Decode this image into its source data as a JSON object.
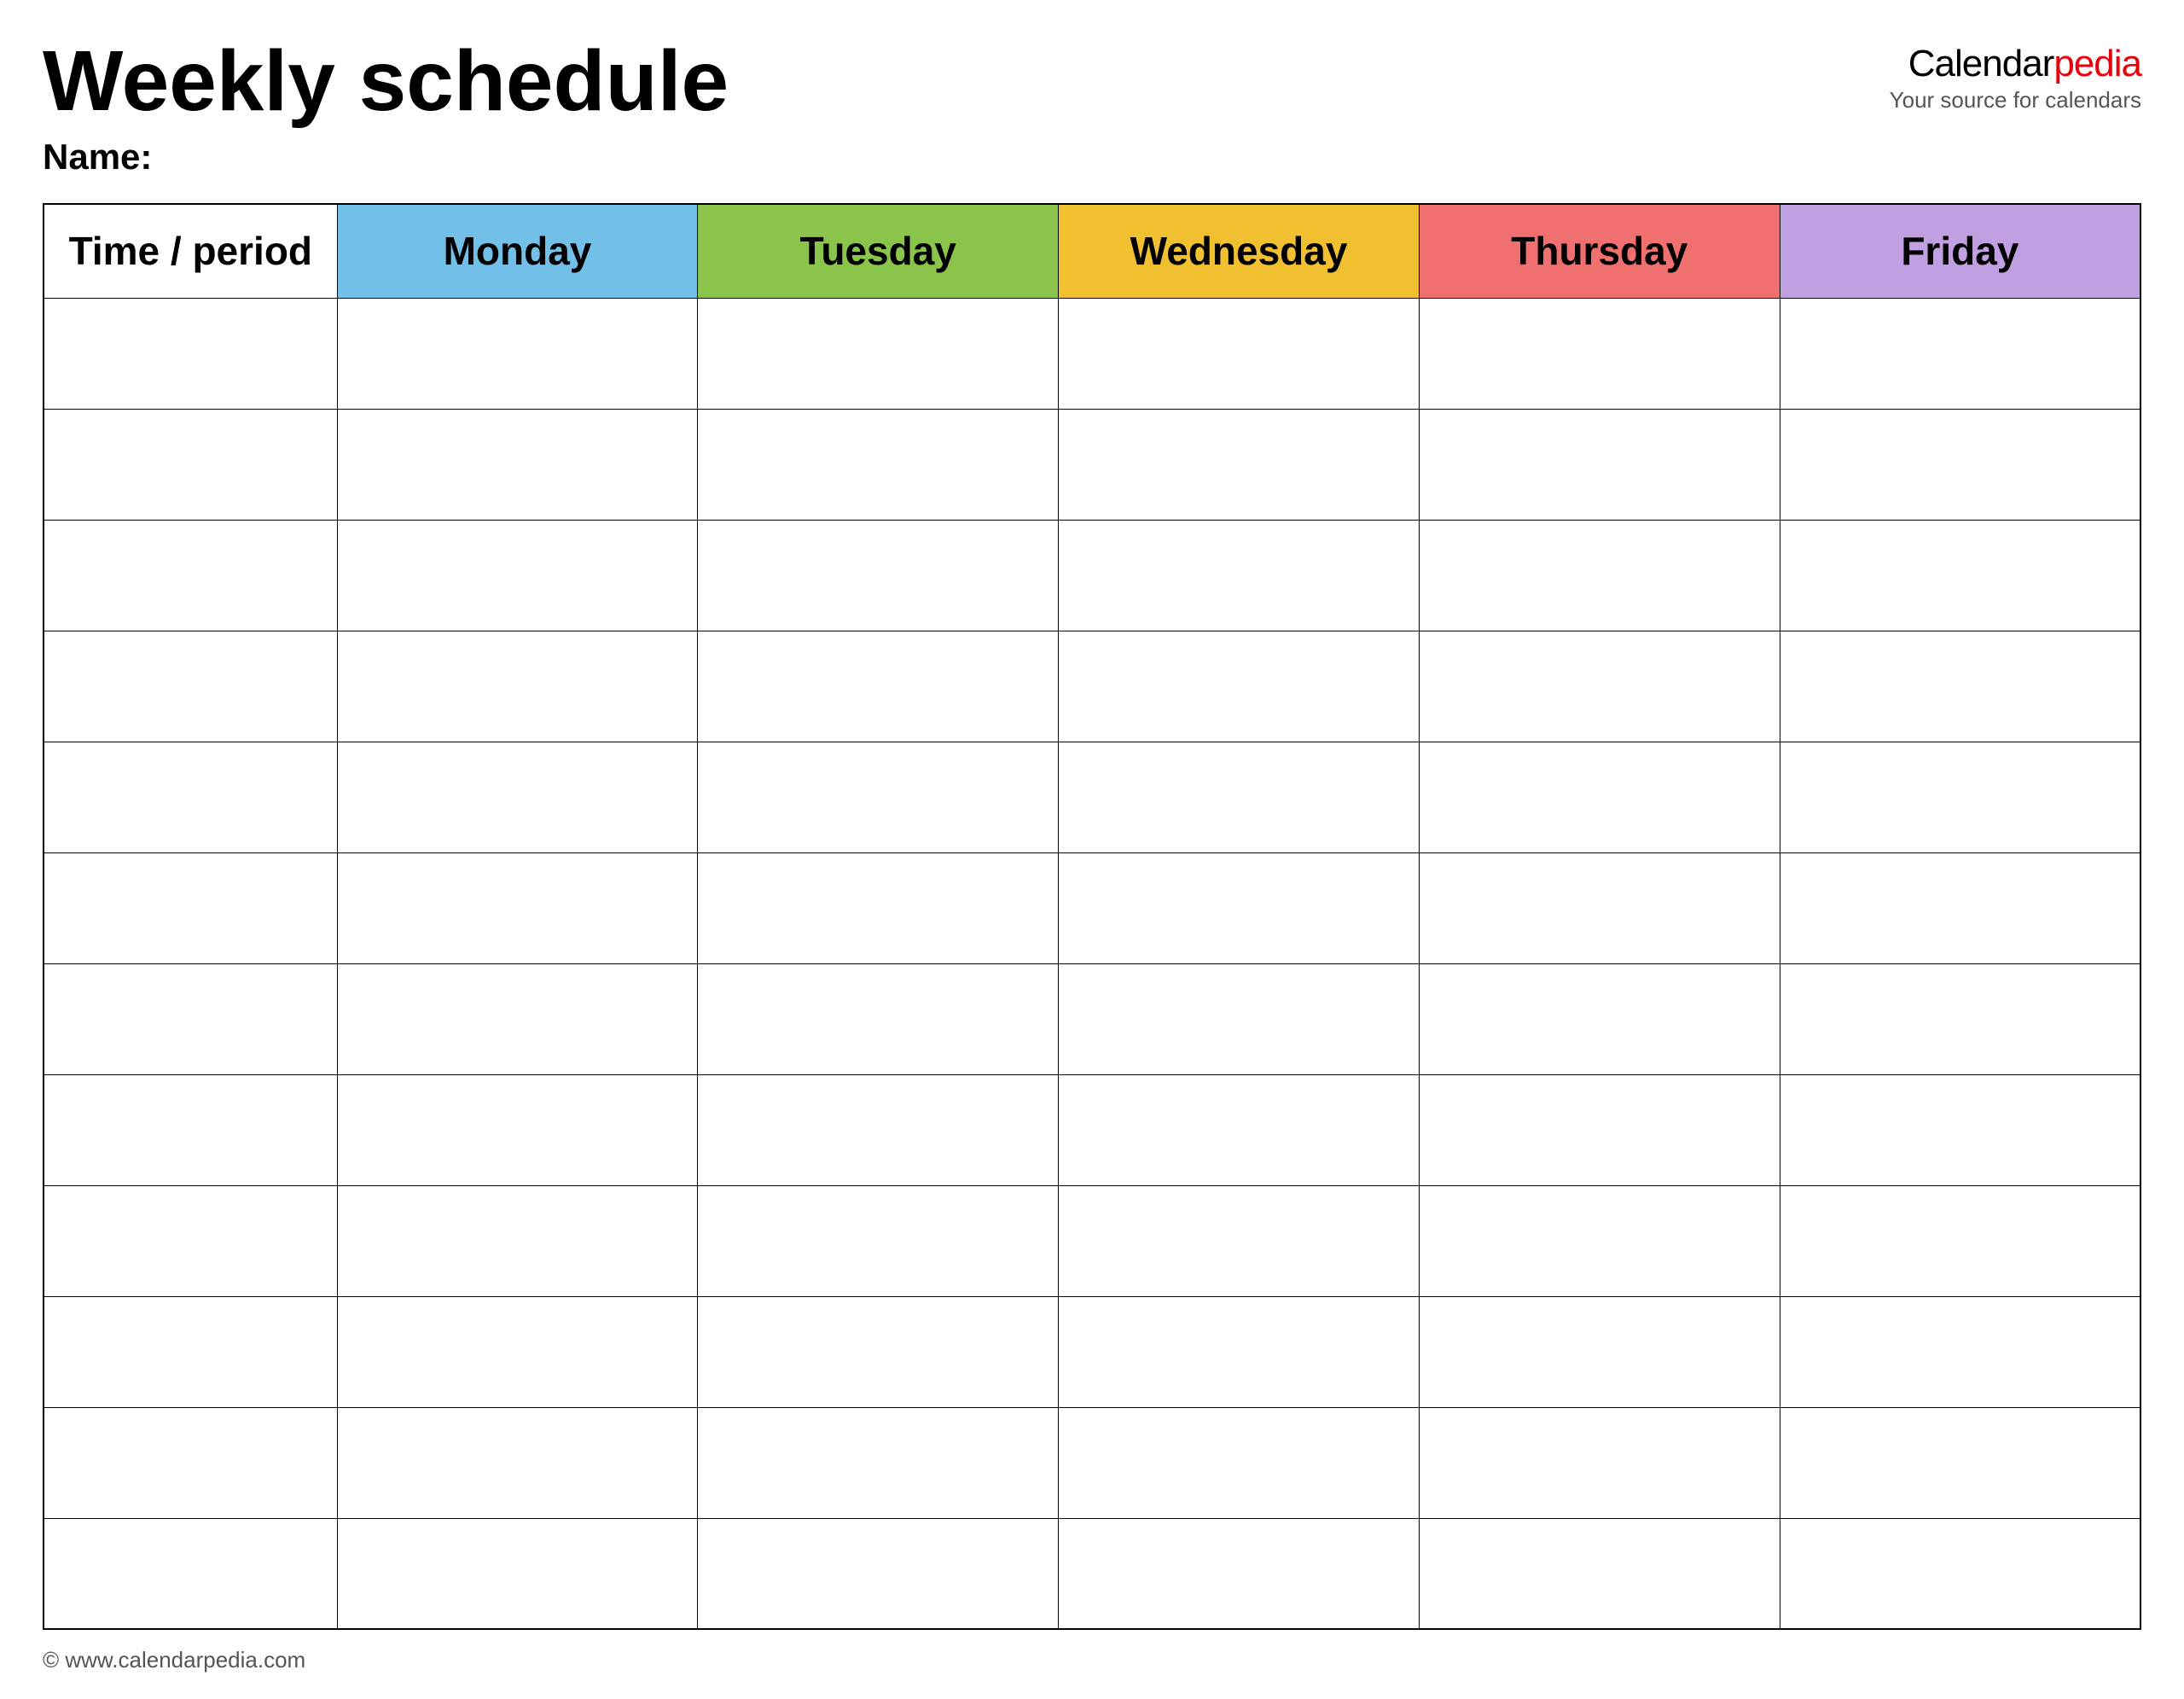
{
  "header": {
    "title": "Weekly schedule",
    "name_label": "Name:",
    "logo_calendar": "Calendar",
    "logo_pedia": "pedia",
    "logo_tagline": "Your source for calendars"
  },
  "table": {
    "columns": [
      {
        "id": "time",
        "label": "Time / period",
        "color": "#ffffff"
      },
      {
        "id": "monday",
        "label": "Monday",
        "color": "#72c0e8"
      },
      {
        "id": "tuesday",
        "label": "Tuesday",
        "color": "#8bc44a"
      },
      {
        "id": "wednesday",
        "label": "Wednesday",
        "color": "#f0c030"
      },
      {
        "id": "thursday",
        "label": "Thursday",
        "color": "#f07070"
      },
      {
        "id": "friday",
        "label": "Friday",
        "color": "#c0a0e0"
      }
    ],
    "row_count": 12
  },
  "footer": {
    "url": "© www.calendarpedia.com"
  }
}
